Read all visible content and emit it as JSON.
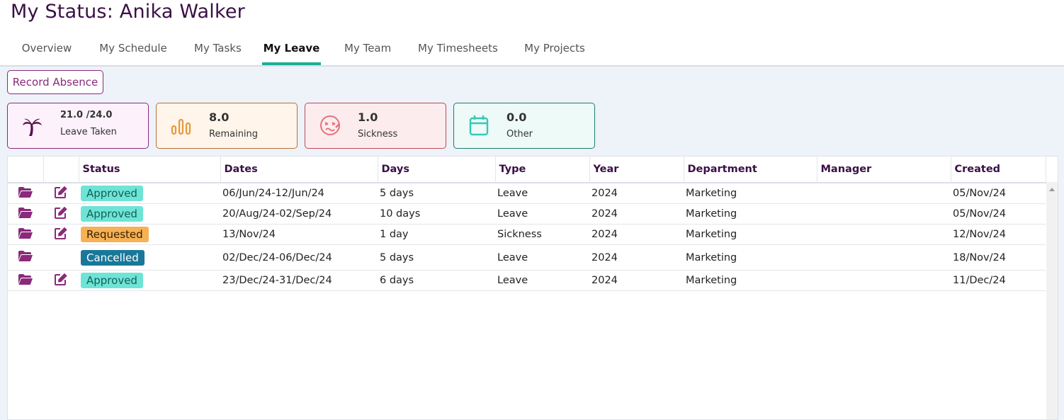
{
  "header": {
    "title": "My Status: Anika Walker"
  },
  "tabs": [
    "Overview",
    "My Schedule",
    "My Tasks",
    "My Leave",
    "My Team",
    "My Timesheets",
    "My Projects"
  ],
  "active_tab": "My Leave",
  "actions": {
    "record_absence": "Record Absence"
  },
  "cards": [
    {
      "value": "21.0 /24.0",
      "label": "Leave Taken",
      "icon": "palm-tree-icon",
      "color": "#5a0f50"
    },
    {
      "value": "8.0",
      "label": "Remaining",
      "icon": "bar-chart-icon",
      "color": "#e59a3a"
    },
    {
      "value": "1.0",
      "label": "Sickness",
      "icon": "sick-face-icon",
      "color": "#e8707e"
    },
    {
      "value": "0.0",
      "label": "Other",
      "icon": "calendar-icon",
      "color": "#35c9b4"
    }
  ],
  "table": {
    "columns": [
      "Status",
      "Dates",
      "Days",
      "Type",
      "Year",
      "Department",
      "Manager",
      "Created"
    ],
    "rows": [
      {
        "status": "Approved",
        "dates": "06/Jun/24-12/Jun/24",
        "days": "5 days",
        "type": "Leave",
        "year": "2024",
        "department": "Marketing",
        "manager": "",
        "created": "05/Nov/24",
        "editable": true
      },
      {
        "status": "Approved",
        "dates": "20/Aug/24-02/Sep/24",
        "days": "10 days",
        "type": "Leave",
        "year": "2024",
        "department": "Marketing",
        "manager": "",
        "created": "05/Nov/24",
        "editable": true
      },
      {
        "status": "Requested",
        "dates": "13/Nov/24",
        "days": "1 day",
        "type": "Sickness",
        "year": "2024",
        "department": "Marketing",
        "manager": "",
        "created": "12/Nov/24",
        "editable": true
      },
      {
        "status": "Cancelled",
        "dates": "02/Dec/24-06/Dec/24",
        "days": "5 days",
        "type": "Leave",
        "year": "2024",
        "department": "Marketing",
        "manager": "",
        "created": "18/Nov/24",
        "editable": false
      },
      {
        "status": "Approved",
        "dates": "23/Dec/24-31/Dec/24",
        "days": "6 days",
        "type": "Leave",
        "year": "2024",
        "department": "Marketing",
        "manager": "",
        "created": "11/Dec/24",
        "editable": true
      }
    ]
  },
  "colors": {
    "title": "#3a1045",
    "accent_tab": "#1aaf95",
    "row_icon": "#8a2a7a"
  }
}
